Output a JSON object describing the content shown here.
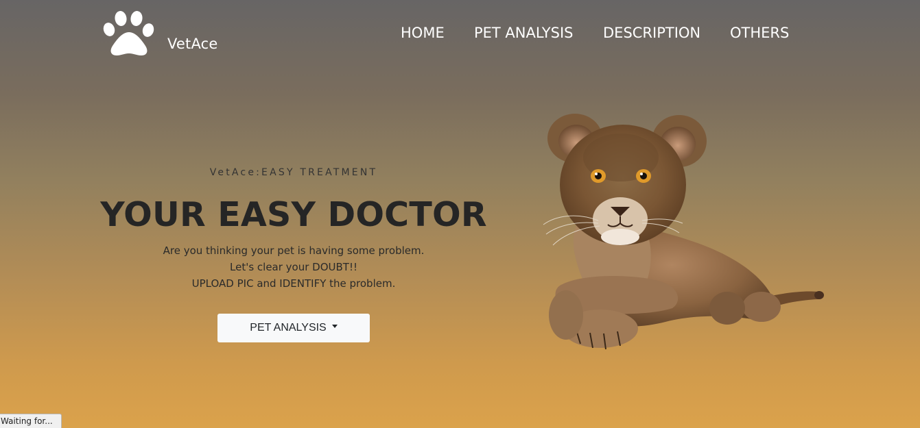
{
  "brand": {
    "name": "VetAce",
    "logo_icon": "paw-icon"
  },
  "nav": {
    "items": [
      {
        "label": "HOME"
      },
      {
        "label": "PET ANALYSIS"
      },
      {
        "label": "DESCRIPTION"
      },
      {
        "label": "OTHERS"
      }
    ]
  },
  "hero": {
    "tagline": "VetAce:EASY TREATMENT",
    "headline": "YOUR EASY DOCTOR",
    "description": [
      "Are you thinking your pet is having some problem.",
      "Let's clear your DOUBT!!",
      "UPLOAD PIC and IDENTIFY the problem."
    ],
    "button_label": "PET ANALYSIS",
    "button_icon": "caret-down-icon",
    "image": "lion-cub-image"
  },
  "browser_status": {
    "text": "Waiting for..."
  },
  "colors": {
    "gradient_top": "#676565",
    "gradient_bottom": "#dba24b",
    "nav_text": "#ffffff",
    "heading_text": "#252525",
    "button_bg": "#f8f9fa"
  }
}
